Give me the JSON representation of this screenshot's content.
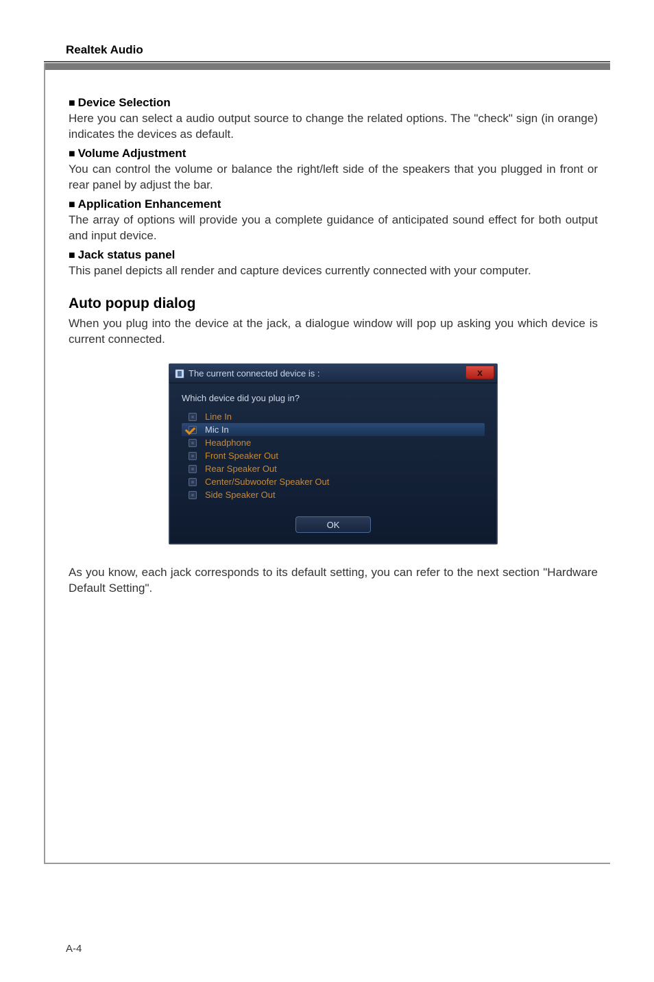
{
  "header": {
    "title": "Realtek Audio"
  },
  "sections": [
    {
      "title": "Device Selection",
      "body": "Here you can select a audio output source to change the related options. The \"check\" sign (in orange) indicates the devices as default."
    },
    {
      "title": "Volume Adjustment",
      "body": "You can control the volume or balance the right/left side of the speakers that you plugged in front or rear panel by adjust the bar."
    },
    {
      "title": "Application Enhancement",
      "body": "The array of options will provide you a complete guidance of anticipated sound effect for both output and input device."
    },
    {
      "title": "Jack status panel",
      "body": "This panel depicts all render and capture devices currently connected with your computer."
    }
  ],
  "auto_popup": {
    "heading": "Auto popup dialog",
    "intro": "When you plug into the device at the jack, a dialogue window will pop up asking you which device is current connected."
  },
  "dialog": {
    "title": "The current connected device is :",
    "question": "Which device did you plug in?",
    "close_label": "x",
    "items": [
      {
        "label": "Line In",
        "selected": false
      },
      {
        "label": "Mic In",
        "selected": true
      },
      {
        "label": "Headphone",
        "selected": false
      },
      {
        "label": "Front Speaker Out",
        "selected": false
      },
      {
        "label": "Rear Speaker Out",
        "selected": false
      },
      {
        "label": "Center/Subwoofer Speaker Out",
        "selected": false
      },
      {
        "label": "Side Speaker Out",
        "selected": false
      }
    ],
    "ok_label": "OK"
  },
  "after": "As you know, each jack corresponds to its default setting, you can refer to the next section \"Hardware Default Setting\".",
  "page_number": "A-4",
  "bullet_char": "■"
}
